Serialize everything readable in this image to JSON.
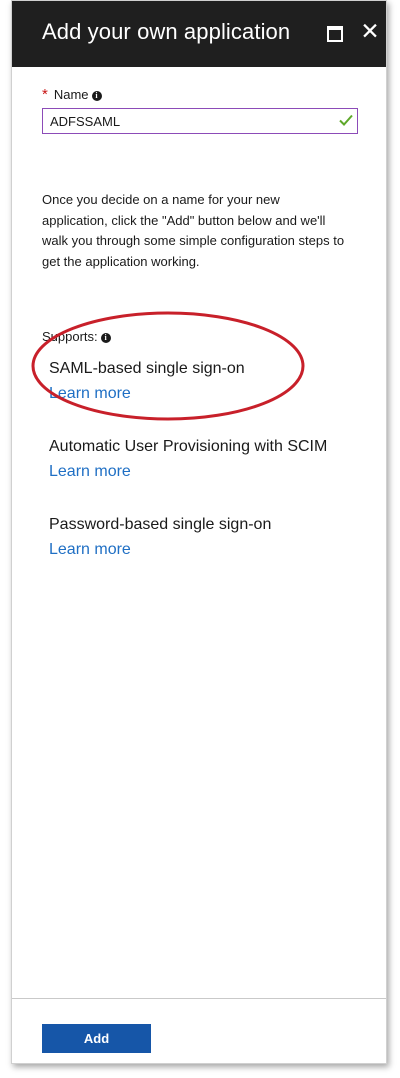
{
  "window": {
    "title": "Add your own application"
  },
  "name_field": {
    "label": "Name",
    "required_marker": "*",
    "value": "ADFSSAML"
  },
  "description": "Once you decide on a name for your new application, click the \"Add\" button below and we'll walk you through some simple configuration steps to get the application working.",
  "supports": {
    "label": "Supports:",
    "features": [
      {
        "name": "SAML-based single sign-on",
        "link": "Learn more"
      },
      {
        "name": "Automatic User Provisioning with SCIM",
        "link": "Learn more"
      },
      {
        "name": "Password-based single sign-on",
        "link": "Learn more"
      }
    ]
  },
  "footer": {
    "add_label": "Add"
  },
  "colors": {
    "title_bar": "#1f1f1f",
    "input_border": "#8c4bb8",
    "checkmark": "#5ea82a",
    "link": "#1f6fc4",
    "primary_button": "#1656a8",
    "required": "#c81414",
    "highlight_ellipse": "#c8202a"
  },
  "icons": {
    "maximize": "maximize-icon",
    "close": "close-icon",
    "info": "info-icon",
    "valid": "checkmark-icon"
  }
}
